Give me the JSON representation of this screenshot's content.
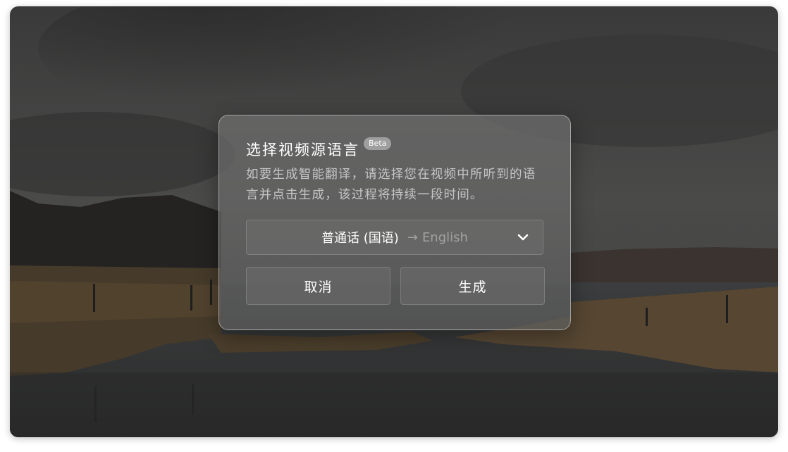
{
  "dialog": {
    "title": "选择视频源语言",
    "badge": "Beta",
    "description": "如要生成智能翻译，请选择您在视频中所听到的语言并点击生成，该过程将持续一段时间。",
    "language_select": {
      "source": "普通话 (国语)",
      "arrow": "→",
      "target": "English",
      "icon": "chevron-down-icon"
    },
    "cancel_label": "取消",
    "generate_label": "生成"
  },
  "colors": {
    "dialog_background": "#6a6a6a",
    "text_primary": "#ffffff",
    "text_muted": "#c8c8c8"
  }
}
